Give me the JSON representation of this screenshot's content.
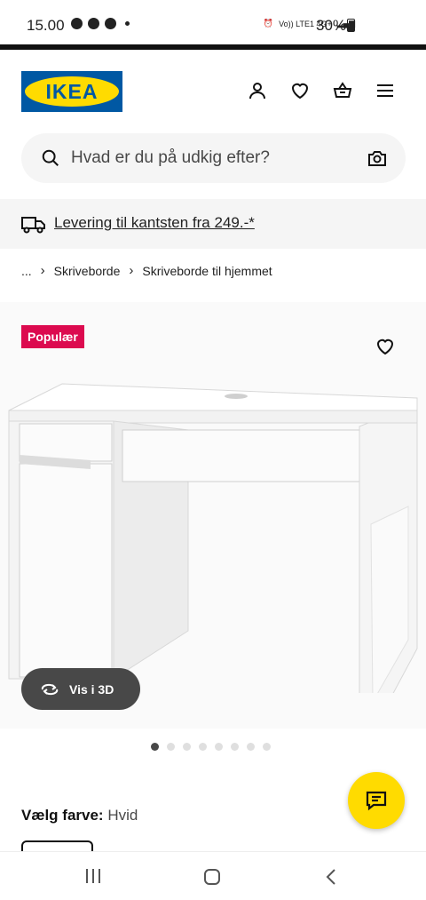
{
  "status_bar": {
    "time": "15.00",
    "network_text": "Vo)) LTE1 4G+",
    "battery": "30%"
  },
  "header": {
    "logo_text": "IKEA",
    "icons": [
      "account-icon",
      "heart-icon",
      "basket-icon",
      "menu-icon"
    ]
  },
  "search": {
    "placeholder": "Hvad er du på udkig efter?",
    "icon": "search-icon",
    "camera_icon": "camera-icon"
  },
  "delivery_banner": {
    "text": "Levering til kantsten fra 249.-*",
    "icon": "truck-icon"
  },
  "breadcrumb": {
    "items": [
      "...",
      "Skriveborde",
      "Skriveborde til hjemmet"
    ]
  },
  "product": {
    "badge": "Populær",
    "view_3d_label": "Vis i 3D",
    "carousel_total": 8,
    "carousel_active": 1
  },
  "color_select": {
    "label": "Vælg farve:",
    "value": "Hvid"
  },
  "colors": {
    "ikea_blue": "#0058a3",
    "ikea_yellow": "#ffdb00",
    "badge_red": "#dc0a4f",
    "dark_button": "#484848"
  }
}
